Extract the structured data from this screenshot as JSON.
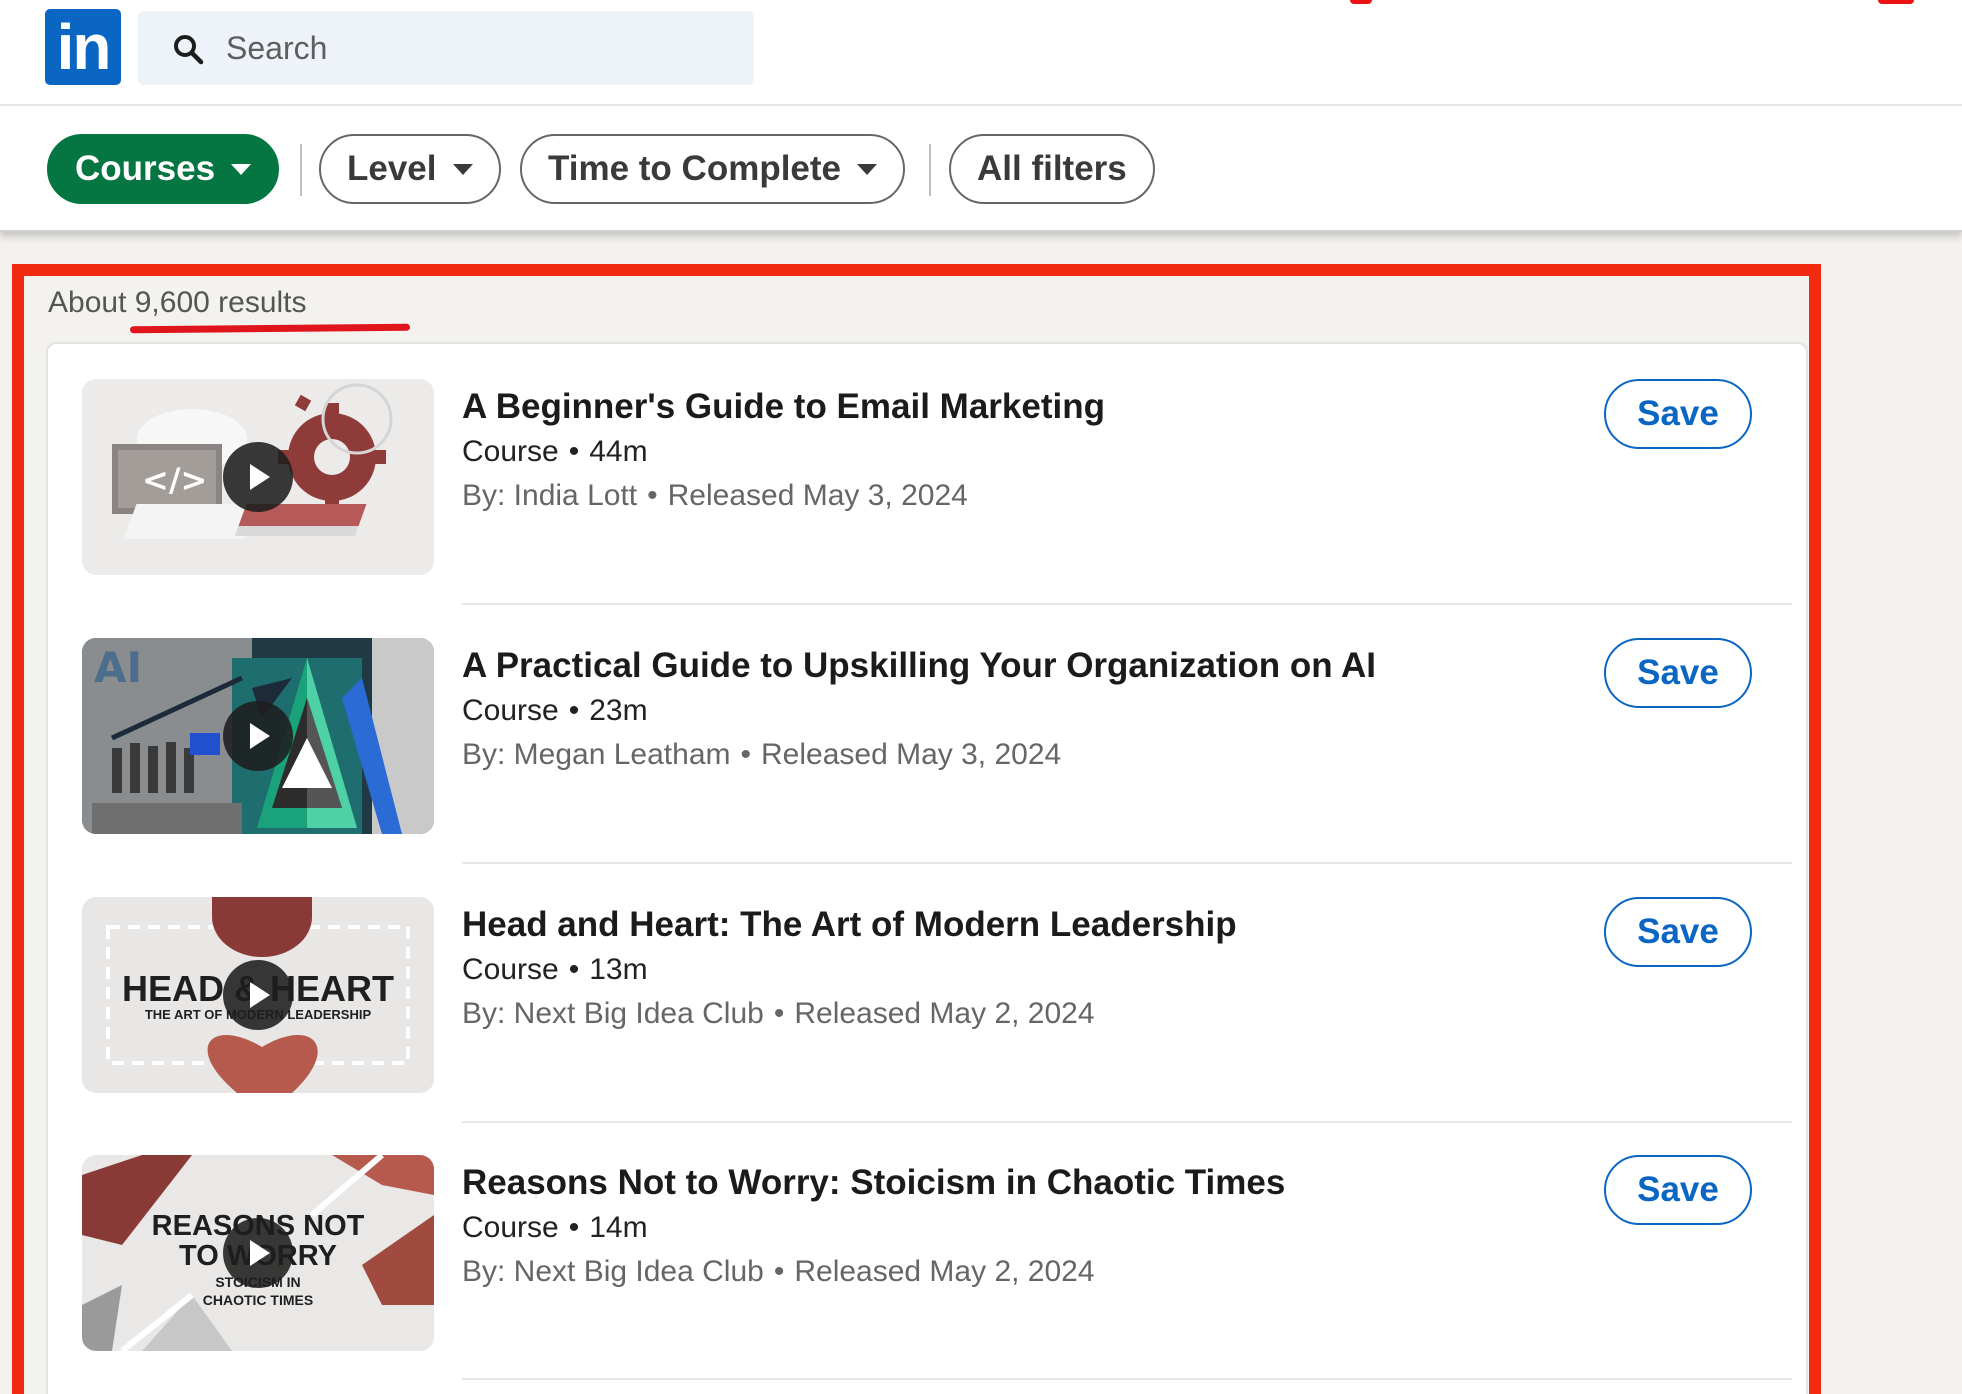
{
  "header": {
    "logo_text": "in",
    "search_placeholder": "Search"
  },
  "filters": {
    "courses": "Courses",
    "level": "Level",
    "time": "Time to Complete",
    "all": "All filters"
  },
  "results": {
    "count_text": "About 9,600 results",
    "items": [
      {
        "title": "A Beginner's Guide to Email Marketing",
        "type": "Course",
        "duration": "44m",
        "author": "By: India Lott",
        "released": "Released May 3, 2024",
        "save_label": "Save",
        "thumb_icon": "code-gear-thumbnail"
      },
      {
        "title": "A Practical Guide to Upskilling Your Organization on AI",
        "type": "Course",
        "duration": "23m",
        "author": "By: Megan Leatham",
        "released": "Released May 3, 2024",
        "save_label": "Save",
        "thumb_icon": "ai-pyramid-thumbnail",
        "thumb_text": "AI"
      },
      {
        "title": "Head and Heart: The Art of Modern Leadership",
        "type": "Course",
        "duration": "13m",
        "author": "By: Next Big Idea Club",
        "released": "Released May 2, 2024",
        "save_label": "Save",
        "thumb_icon": "head-heart-thumbnail",
        "thumb_text": "HEAD & HEART",
        "thumb_subtext": "THE ART OF MODERN LEADERSHIP"
      },
      {
        "title": "Reasons Not to Worry: Stoicism in Chaotic Times",
        "type": "Course",
        "duration": "14m",
        "author": "By: Next Big Idea Club",
        "released": "Released May 2, 2024",
        "save_label": "Save",
        "thumb_icon": "reasons-not-to-worry-thumbnail",
        "thumb_text_1": "REASONS NOT",
        "thumb_text_2": "TO WORRY",
        "thumb_text_3": "STOICISM IN",
        "thumb_text_4": "CHAOTIC TIMES"
      }
    ]
  },
  "colors": {
    "brand": "#0a66c2",
    "active_filter": "#057642",
    "annotation_red": "#f22a10"
  }
}
